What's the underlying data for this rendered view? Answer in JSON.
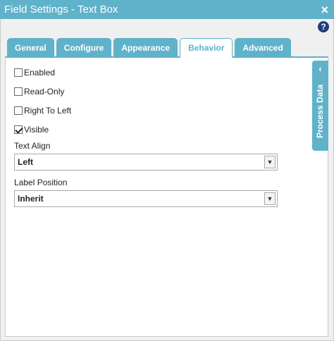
{
  "window": {
    "title": "Field Settings - Text Box",
    "close_glyph": "×"
  },
  "help": {
    "glyph": "?"
  },
  "tabs": [
    {
      "label": "General"
    },
    {
      "label": "Configure"
    },
    {
      "label": "Appearance"
    },
    {
      "label": "Behavior",
      "active": true
    },
    {
      "label": "Advanced"
    }
  ],
  "behavior": {
    "enabled": {
      "label": "Enabled",
      "checked": false
    },
    "read_only": {
      "label": "Read-Only",
      "checked": false
    },
    "right_to_left": {
      "label": "Right To Left",
      "checked": false
    },
    "visible": {
      "label": "Visible",
      "checked": true
    },
    "text_align": {
      "label": "Text Align",
      "value": "Left"
    },
    "label_position": {
      "label": "Label Position",
      "value": "Inherit"
    }
  },
  "side_panel": {
    "label": "Process Data",
    "chevron": "‹"
  },
  "colors": {
    "accent": "#5fb2c9",
    "help_bg": "#1f3f7a"
  }
}
